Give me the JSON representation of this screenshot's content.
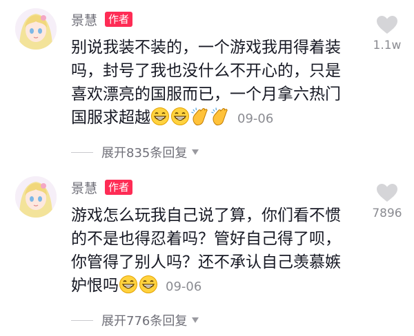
{
  "comments": [
    {
      "username": "景慧",
      "badge": "作者",
      "text": "别说我装不装的，一个游戏我用得着装吗，封号了我也没什么不开心的，只是喜欢漂亮的国服而已，一个月拿六热门国服求超越",
      "emojis": [
        "grin-icon",
        "grin-icon",
        "clap-icon",
        "clap-icon"
      ],
      "date": "09-06",
      "likes": "1.1w",
      "expand_label": "展开835条回复"
    },
    {
      "username": "景慧",
      "badge": "作者",
      "text": "游戏怎么玩我自己说了算，你们看不惯的不是也得忍着吗？管好自己得了呗，你管得了别人吗？还不承认自己羡慕嫉妒恨吗",
      "emojis": [
        "grin-icon",
        "grin-icon"
      ],
      "date": "09-06",
      "likes": "7896",
      "expand_label": "展开776条回复"
    }
  ],
  "colors": {
    "badge": "#fe2c55",
    "meta": "#8a8b91",
    "heart": "#d5d5d8"
  }
}
